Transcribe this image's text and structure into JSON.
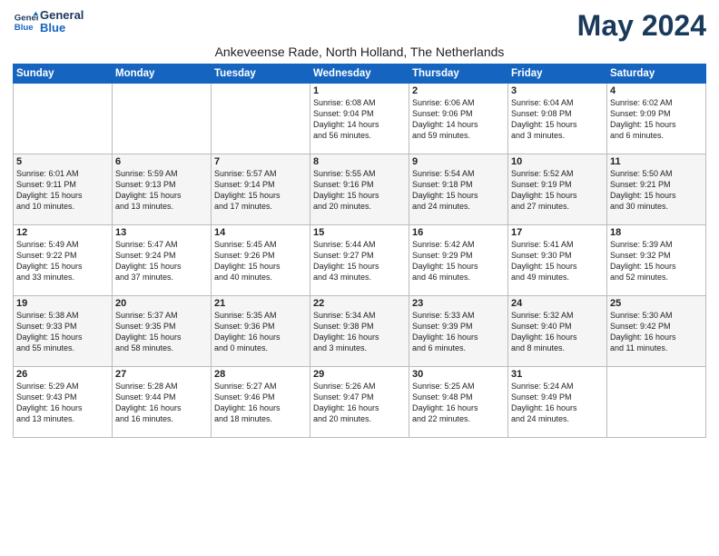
{
  "logo": {
    "line1": "General",
    "line2": "Blue"
  },
  "title": "May 2024",
  "subtitle": "Ankeveense Rade, North Holland, The Netherlands",
  "days_of_week": [
    "Sunday",
    "Monday",
    "Tuesday",
    "Wednesday",
    "Thursday",
    "Friday",
    "Saturday"
  ],
  "weeks": [
    [
      {
        "day": "",
        "info": ""
      },
      {
        "day": "",
        "info": ""
      },
      {
        "day": "",
        "info": ""
      },
      {
        "day": "1",
        "info": "Sunrise: 6:08 AM\nSunset: 9:04 PM\nDaylight: 14 hours\nand 56 minutes."
      },
      {
        "day": "2",
        "info": "Sunrise: 6:06 AM\nSunset: 9:06 PM\nDaylight: 14 hours\nand 59 minutes."
      },
      {
        "day": "3",
        "info": "Sunrise: 6:04 AM\nSunset: 9:08 PM\nDaylight: 15 hours\nand 3 minutes."
      },
      {
        "day": "4",
        "info": "Sunrise: 6:02 AM\nSunset: 9:09 PM\nDaylight: 15 hours\nand 6 minutes."
      }
    ],
    [
      {
        "day": "5",
        "info": "Sunrise: 6:01 AM\nSunset: 9:11 PM\nDaylight: 15 hours\nand 10 minutes."
      },
      {
        "day": "6",
        "info": "Sunrise: 5:59 AM\nSunset: 9:13 PM\nDaylight: 15 hours\nand 13 minutes."
      },
      {
        "day": "7",
        "info": "Sunrise: 5:57 AM\nSunset: 9:14 PM\nDaylight: 15 hours\nand 17 minutes."
      },
      {
        "day": "8",
        "info": "Sunrise: 5:55 AM\nSunset: 9:16 PM\nDaylight: 15 hours\nand 20 minutes."
      },
      {
        "day": "9",
        "info": "Sunrise: 5:54 AM\nSunset: 9:18 PM\nDaylight: 15 hours\nand 24 minutes."
      },
      {
        "day": "10",
        "info": "Sunrise: 5:52 AM\nSunset: 9:19 PM\nDaylight: 15 hours\nand 27 minutes."
      },
      {
        "day": "11",
        "info": "Sunrise: 5:50 AM\nSunset: 9:21 PM\nDaylight: 15 hours\nand 30 minutes."
      }
    ],
    [
      {
        "day": "12",
        "info": "Sunrise: 5:49 AM\nSunset: 9:22 PM\nDaylight: 15 hours\nand 33 minutes."
      },
      {
        "day": "13",
        "info": "Sunrise: 5:47 AM\nSunset: 9:24 PM\nDaylight: 15 hours\nand 37 minutes."
      },
      {
        "day": "14",
        "info": "Sunrise: 5:45 AM\nSunset: 9:26 PM\nDaylight: 15 hours\nand 40 minutes."
      },
      {
        "day": "15",
        "info": "Sunrise: 5:44 AM\nSunset: 9:27 PM\nDaylight: 15 hours\nand 43 minutes."
      },
      {
        "day": "16",
        "info": "Sunrise: 5:42 AM\nSunset: 9:29 PM\nDaylight: 15 hours\nand 46 minutes."
      },
      {
        "day": "17",
        "info": "Sunrise: 5:41 AM\nSunset: 9:30 PM\nDaylight: 15 hours\nand 49 minutes."
      },
      {
        "day": "18",
        "info": "Sunrise: 5:39 AM\nSunset: 9:32 PM\nDaylight: 15 hours\nand 52 minutes."
      }
    ],
    [
      {
        "day": "19",
        "info": "Sunrise: 5:38 AM\nSunset: 9:33 PM\nDaylight: 15 hours\nand 55 minutes."
      },
      {
        "day": "20",
        "info": "Sunrise: 5:37 AM\nSunset: 9:35 PM\nDaylight: 15 hours\nand 58 minutes."
      },
      {
        "day": "21",
        "info": "Sunrise: 5:35 AM\nSunset: 9:36 PM\nDaylight: 16 hours\nand 0 minutes."
      },
      {
        "day": "22",
        "info": "Sunrise: 5:34 AM\nSunset: 9:38 PM\nDaylight: 16 hours\nand 3 minutes."
      },
      {
        "day": "23",
        "info": "Sunrise: 5:33 AM\nSunset: 9:39 PM\nDaylight: 16 hours\nand 6 minutes."
      },
      {
        "day": "24",
        "info": "Sunrise: 5:32 AM\nSunset: 9:40 PM\nDaylight: 16 hours\nand 8 minutes."
      },
      {
        "day": "25",
        "info": "Sunrise: 5:30 AM\nSunset: 9:42 PM\nDaylight: 16 hours\nand 11 minutes."
      }
    ],
    [
      {
        "day": "26",
        "info": "Sunrise: 5:29 AM\nSunset: 9:43 PM\nDaylight: 16 hours\nand 13 minutes."
      },
      {
        "day": "27",
        "info": "Sunrise: 5:28 AM\nSunset: 9:44 PM\nDaylight: 16 hours\nand 16 minutes."
      },
      {
        "day": "28",
        "info": "Sunrise: 5:27 AM\nSunset: 9:46 PM\nDaylight: 16 hours\nand 18 minutes."
      },
      {
        "day": "29",
        "info": "Sunrise: 5:26 AM\nSunset: 9:47 PM\nDaylight: 16 hours\nand 20 minutes."
      },
      {
        "day": "30",
        "info": "Sunrise: 5:25 AM\nSunset: 9:48 PM\nDaylight: 16 hours\nand 22 minutes."
      },
      {
        "day": "31",
        "info": "Sunrise: 5:24 AM\nSunset: 9:49 PM\nDaylight: 16 hours\nand 24 minutes."
      },
      {
        "day": "",
        "info": ""
      }
    ]
  ]
}
